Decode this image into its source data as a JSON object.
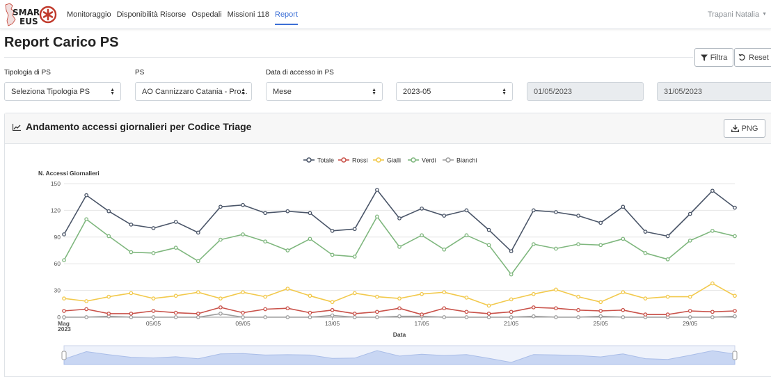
{
  "app": {
    "logo_text_1": "SMAR",
    "logo_text_2": "EUS"
  },
  "nav": {
    "items": [
      {
        "label": "Monitoraggio",
        "active": false
      },
      {
        "label": "Disponibilità Risorse",
        "active": false
      },
      {
        "label": "Ospedali",
        "active": false
      },
      {
        "label": "Missioni 118",
        "active": false
      },
      {
        "label": "Report",
        "active": true
      }
    ],
    "user": "Trapani Natalia"
  },
  "page": {
    "title": "Report Carico PS"
  },
  "toolbar": {
    "filter_label": "Filtra",
    "reset_label": "Reset"
  },
  "filters": {
    "tipologia_label": "Tipologia di PS",
    "tipologia_value": "Seleziona Tipologia PS",
    "ps_label": "PS",
    "ps_value": "AO Cannizzaro Catania - Pro...",
    "data_label": "Data di accesso in PS",
    "period_value": "Mese",
    "month_value": "2023-05",
    "date_from": "01/05/2023",
    "date_to": "31/05/2023"
  },
  "card": {
    "title": "Andamento accessi giornalieri per Codice Triage",
    "png_label": "PNG"
  },
  "colors": {
    "accent": "#3c6fd6",
    "totale": "#4a5568",
    "rossi": "#c9524a",
    "gialli": "#f2c94c",
    "verdi": "#7fb77e",
    "bianchi": "#9e9e9e"
  },
  "chart_data": {
    "type": "line",
    "ylabel": "N. Accessi Giornalieri",
    "xlabel": "Data",
    "ylim": [
      0,
      150
    ],
    "yticks": [
      0,
      30,
      60,
      90,
      120,
      150
    ],
    "x": [
      "2023-05-01",
      "2023-05-02",
      "2023-05-03",
      "2023-05-04",
      "2023-05-05",
      "2023-05-06",
      "2023-05-07",
      "2023-05-08",
      "2023-05-09",
      "2023-05-10",
      "2023-05-11",
      "2023-05-12",
      "2023-05-13",
      "2023-05-14",
      "2023-05-15",
      "2023-05-16",
      "2023-05-17",
      "2023-05-18",
      "2023-05-19",
      "2023-05-20",
      "2023-05-21",
      "2023-05-22",
      "2023-05-23",
      "2023-05-24",
      "2023-05-25",
      "2023-05-26",
      "2023-05-27",
      "2023-05-28",
      "2023-05-29",
      "2023-05-30",
      "2023-05-31"
    ],
    "xtick_labels": [
      {
        "index": 0,
        "label": "Mag",
        "sub": "2023"
      },
      {
        "index": 4,
        "label": "05/05"
      },
      {
        "index": 8,
        "label": "09/05"
      },
      {
        "index": 12,
        "label": "13/05"
      },
      {
        "index": 16,
        "label": "17/05"
      },
      {
        "index": 20,
        "label": "21/05"
      },
      {
        "index": 24,
        "label": "25/05"
      },
      {
        "index": 28,
        "label": "29/05"
      }
    ],
    "legend_position": "top-center",
    "grid": true,
    "series": [
      {
        "name": "Totale",
        "color": "#4a5568",
        "values": [
          93,
          137,
          119,
          104,
          100,
          107,
          95,
          124,
          126,
          117,
          119,
          117,
          97,
          99,
          143,
          111,
          122,
          114,
          120,
          98,
          74,
          120,
          118,
          114,
          106,
          124,
          96,
          91,
          116,
          142,
          123
        ]
      },
      {
        "name": "Rossi",
        "color": "#c9524a",
        "values": [
          7,
          9,
          4,
          4,
          7,
          5,
          4,
          11,
          5,
          9,
          10,
          5,
          8,
          4,
          6,
          10,
          3,
          10,
          6,
          4,
          6,
          11,
          10,
          8,
          7,
          8,
          3,
          3,
          7,
          6,
          7
        ]
      },
      {
        "name": "Gialli",
        "color": "#f2c94c",
        "values": [
          21,
          18,
          23,
          27,
          21,
          24,
          28,
          21,
          28,
          23,
          32,
          24,
          17,
          27,
          23,
          21,
          26,
          28,
          22,
          13,
          20,
          26,
          31,
          23,
          17,
          28,
          21,
          23,
          23,
          38,
          24
        ]
      },
      {
        "name": "Verdi",
        "color": "#7fb77e",
        "values": [
          64,
          110,
          91,
          73,
          72,
          78,
          63,
          87,
          93,
          85,
          75,
          88,
          70,
          68,
          113,
          79,
          92,
          76,
          92,
          81,
          48,
          82,
          77,
          82,
          81,
          88,
          72,
          65,
          86,
          97,
          91
        ]
      },
      {
        "name": "Bianchi",
        "color": "#9e9e9e",
        "values": [
          0,
          0,
          1,
          0,
          0,
          0,
          0,
          4,
          0,
          0,
          0,
          0,
          2,
          0,
          0,
          1,
          1,
          0,
          0,
          0,
          0,
          1,
          0,
          0,
          1,
          0,
          0,
          0,
          0,
          0,
          1
        ]
      }
    ]
  }
}
